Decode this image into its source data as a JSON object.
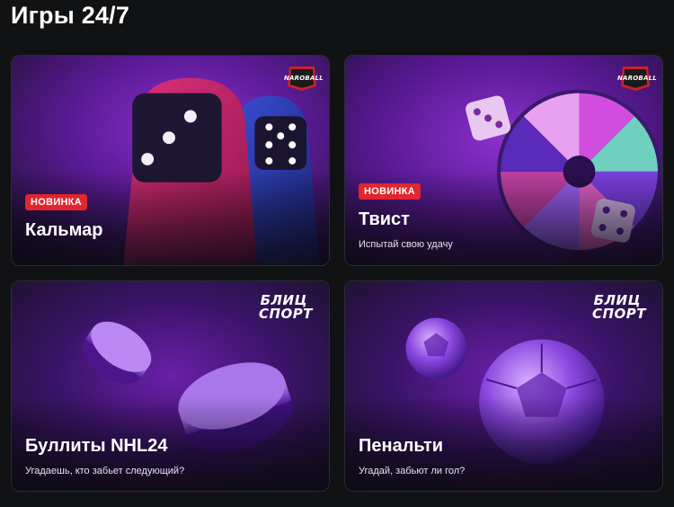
{
  "page": {
    "title": "Игры 24/7"
  },
  "cards": [
    {
      "title": "Кальмар",
      "badge": "НОВИНКА",
      "subtitle": "",
      "provider": "NAROBALL",
      "art": "squid-dice-characters"
    },
    {
      "title": "Твист",
      "badge": "НОВИНКА",
      "subtitle": "Испытай свою удачу",
      "provider": "NAROBALL",
      "art": "wheel-and-dice"
    },
    {
      "title": "Буллиты NHL24",
      "badge": "",
      "subtitle": "Угадаешь, кто забьет следующий?",
      "provider_line1": "БЛИЦ",
      "provider_line2": "СПОРТ",
      "art": "hockey-pucks"
    },
    {
      "title": "Пенальти",
      "badge": "",
      "subtitle": "Угадай, забьют ли гол?",
      "provider_line1": "БЛИЦ",
      "provider_line2": "СПОРТ",
      "art": "soccer-balls"
    }
  ],
  "colors": {
    "background": "#111214",
    "badge": "#e0262f",
    "card_purple": "#6b1fa8",
    "card_dark": "#14101c"
  }
}
